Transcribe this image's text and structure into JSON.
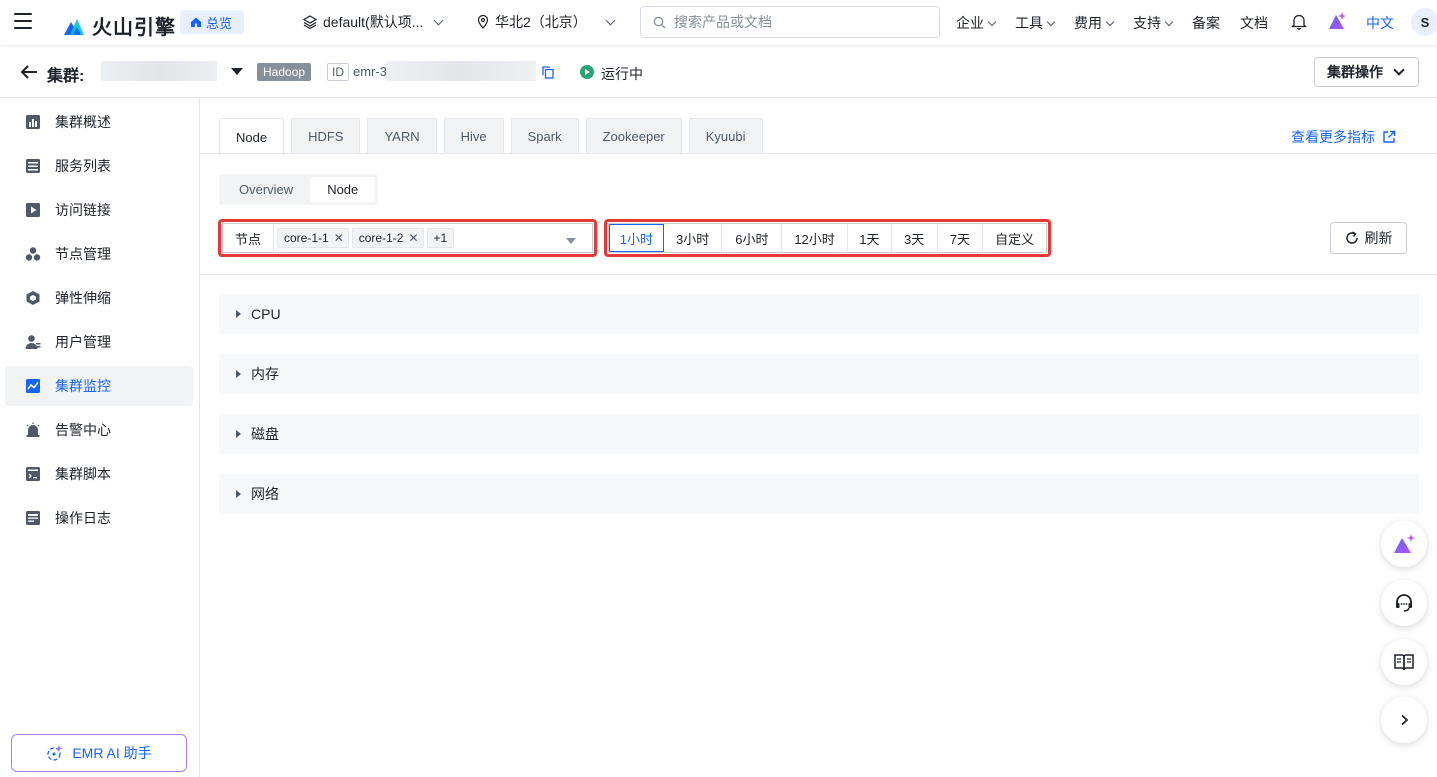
{
  "topbar": {
    "brand": "火山引擎",
    "overview": "总览",
    "project": "default(默认项...",
    "region": "华北2（北京）",
    "search_placeholder": "搜索产品或文档",
    "nav": [
      "企业",
      "工具",
      "费用",
      "支持",
      "备案",
      "文档"
    ],
    "language": "中文",
    "avatar_initial": "S"
  },
  "cluster": {
    "label": "集群:",
    "engine_tag": "Hadoop",
    "id_label": "ID",
    "id_value": "emr-3",
    "status": "运行中",
    "operations": "集群操作"
  },
  "sidebar": {
    "items": [
      {
        "label": "集群概述",
        "icon": "bar-chart-icon"
      },
      {
        "label": "服务列表",
        "icon": "list-icon"
      },
      {
        "label": "访问链接",
        "icon": "play-square-icon"
      },
      {
        "label": "节点管理",
        "icon": "nodes-icon"
      },
      {
        "label": "弹性伸缩",
        "icon": "elastic-icon"
      },
      {
        "label": "用户管理",
        "icon": "user-icon"
      },
      {
        "label": "集群监控",
        "icon": "monitor-icon"
      },
      {
        "label": "告警中心",
        "icon": "alarm-icon"
      },
      {
        "label": "集群脚本",
        "icon": "script-icon"
      },
      {
        "label": "操作日志",
        "icon": "log-icon"
      }
    ],
    "active_index": 6,
    "assistant": "EMR AI 助手"
  },
  "main": {
    "tabs": [
      "Node",
      "HDFS",
      "YARN",
      "Hive",
      "Spark",
      "Zookeeper",
      "Kyuubi"
    ],
    "active_tab": 0,
    "more_metrics": "查看更多指标",
    "view_switch": [
      "Overview",
      "Node"
    ],
    "active_view": 1,
    "node_filter": {
      "label": "节点",
      "chips": [
        "core-1-1",
        "core-1-2"
      ],
      "more": "+1"
    },
    "time_ranges": [
      "1小时",
      "3小时",
      "6小时",
      "12小时",
      "1天",
      "3天",
      "7天",
      "自定义"
    ],
    "active_time": 0,
    "refresh": "刷新",
    "panels": [
      "CPU",
      "内存",
      "磁盘",
      "网络"
    ]
  },
  "colors": {
    "accent": "#1664ff",
    "highlight_border": "#e53935",
    "running": "#2ba471"
  }
}
